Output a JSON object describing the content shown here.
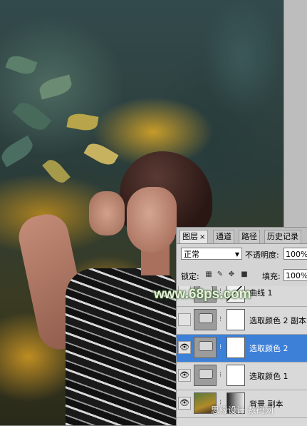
{
  "panel": {
    "tabs": [
      {
        "label": "图层",
        "close": "×"
      },
      {
        "label": "通道"
      },
      {
        "label": "路径"
      },
      {
        "label": "历史记录"
      }
    ],
    "blend_mode": "正常",
    "opacity_label": "不透明度:",
    "opacity_value": "100%",
    "lock_label": "锁定:",
    "fill_label": "填充:",
    "fill_value": "100%",
    "layers": [
      {
        "name": "曲线 1",
        "visible": false,
        "selected": false
      },
      {
        "name": "选取颜色 2 副本",
        "visible": false,
        "selected": false
      },
      {
        "name": "选取颜色 2",
        "visible": true,
        "selected": true
      },
      {
        "name": "选取颜色 1",
        "visible": true,
        "selected": false
      },
      {
        "name": "背景 副本",
        "visible": true,
        "selected": false
      }
    ]
  },
  "watermark": {
    "site": "www.68ps.com",
    "corner": "思缘设计 数码网"
  },
  "colors": {
    "selection": "#3d80d8",
    "panel_bg": "#d4d4d4"
  }
}
